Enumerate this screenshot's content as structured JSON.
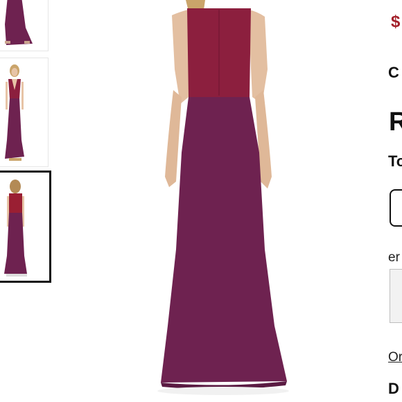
{
  "product": {
    "price": "$",
    "brand": "C",
    "title": "R",
    "size_label": "To",
    "email_label": "er",
    "link_label": "Or",
    "details_label": "D"
  },
  "colors": {
    "accent_price": "#a3202a",
    "bodice": "#8c1f3e",
    "skirt": "#6e2250"
  },
  "gallery": {
    "selected_index": 2
  }
}
